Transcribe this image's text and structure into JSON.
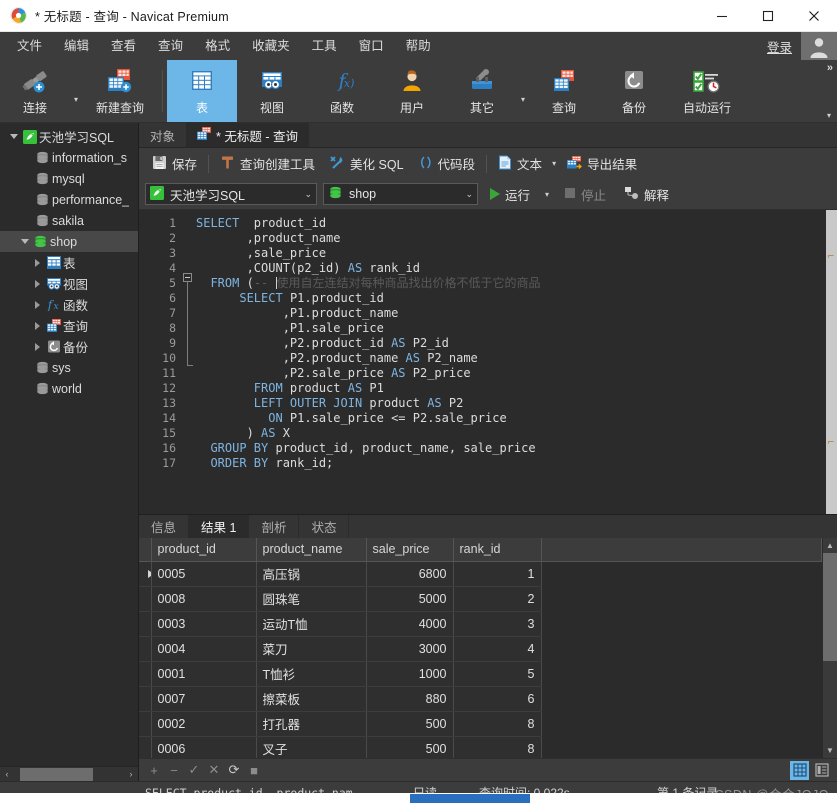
{
  "window": {
    "title": "* 无标题 - 查询 - Navicat Premium",
    "minimize": "—",
    "maximize": "□",
    "close": "✕"
  },
  "menubar": {
    "items": [
      "文件",
      "编辑",
      "查看",
      "查询",
      "格式",
      "收藏夹",
      "工具",
      "窗口",
      "帮助"
    ],
    "login_label": "登录"
  },
  "ribbon": {
    "items": [
      {
        "label": "连接",
        "icon": "connection-icon",
        "selected": false,
        "has_caret": true
      },
      {
        "label": "新建查询",
        "icon": "new-query-icon",
        "selected": false,
        "has_caret": false
      },
      {
        "label": "表",
        "icon": "table-icon",
        "selected": true,
        "has_caret": false
      },
      {
        "label": "视图",
        "icon": "view-icon",
        "selected": false,
        "has_caret": false
      },
      {
        "label": "函数",
        "icon": "function-icon",
        "selected": false,
        "has_caret": false
      },
      {
        "label": "用户",
        "icon": "user-icon",
        "selected": false,
        "has_caret": false
      },
      {
        "label": "其它",
        "icon": "other-tools-icon",
        "selected": false,
        "has_caret": true
      },
      {
        "label": "查询",
        "icon": "query-icon",
        "selected": false,
        "has_caret": false
      },
      {
        "label": "备份",
        "icon": "backup-icon",
        "selected": false,
        "has_caret": false
      },
      {
        "label": "自动运行",
        "icon": "automation-icon",
        "selected": false,
        "has_caret": false
      }
    ],
    "overflow_chevrons": "»"
  },
  "sidebar": {
    "items": [
      {
        "label": "天池学习SQL",
        "icon": "connection-icon",
        "indent": 0,
        "twisty": "down",
        "selected": false
      },
      {
        "label": "information_s",
        "icon": "database-icon",
        "indent": 1,
        "twisty": "none",
        "selected": false
      },
      {
        "label": "mysql",
        "icon": "database-icon",
        "indent": 1,
        "twisty": "none",
        "selected": false
      },
      {
        "label": "performance_",
        "icon": "database-icon",
        "indent": 1,
        "twisty": "none",
        "selected": false
      },
      {
        "label": "sakila",
        "icon": "database-icon",
        "indent": 1,
        "twisty": "none",
        "selected": false
      },
      {
        "label": "shop",
        "icon": "database-open-icon",
        "indent": 1,
        "twisty": "down",
        "selected": true
      },
      {
        "label": "表",
        "icon": "table-icon",
        "indent": 2,
        "twisty": "right",
        "selected": false
      },
      {
        "label": "视图",
        "icon": "view-icon",
        "indent": 2,
        "twisty": "right",
        "selected": false
      },
      {
        "label": "函数",
        "icon": "function-icon",
        "indent": 2,
        "twisty": "right",
        "selected": false
      },
      {
        "label": "查询",
        "icon": "query-icon",
        "indent": 2,
        "twisty": "right",
        "selected": false
      },
      {
        "label": "备份",
        "icon": "backup-icon",
        "indent": 2,
        "twisty": "right",
        "selected": false
      },
      {
        "label": "sys",
        "icon": "database-icon",
        "indent": 1,
        "twisty": "none",
        "selected": false
      },
      {
        "label": "world",
        "icon": "database-icon",
        "indent": 1,
        "twisty": "none",
        "selected": false
      }
    ],
    "hscroll": {
      "left_arrow": "‹",
      "right_arrow": "›"
    }
  },
  "object_tabs": [
    {
      "label": "对象",
      "active": false
    },
    {
      "label": "* 无标题 - 查询",
      "active": true
    }
  ],
  "query_toolbar": {
    "save": "保存",
    "query_builder": "查询创建工具",
    "beautify": "美化 SQL",
    "snippet": "代码段",
    "text": "文本",
    "export_result": "导出结果"
  },
  "query_toolbar2": {
    "connection": "天池学习SQL",
    "database": "shop",
    "run": "运行",
    "stop": "停止",
    "explain": "解释"
  },
  "editor": {
    "lines": [
      {
        "n": 1,
        "segs": [
          {
            "t": "kw",
            "s": "SELECT"
          },
          {
            "t": "p",
            "s": "  product_id"
          }
        ]
      },
      {
        "n": 2,
        "segs": [
          {
            "t": "p",
            "s": "       ,product_name"
          }
        ]
      },
      {
        "n": 3,
        "segs": [
          {
            "t": "p",
            "s": "       ,sale_price"
          }
        ]
      },
      {
        "n": 4,
        "segs": [
          {
            "t": "p",
            "s": "       ,COUNT(p2_id) "
          },
          {
            "t": "kw",
            "s": "AS"
          },
          {
            "t": "p",
            "s": " rank_id"
          }
        ]
      },
      {
        "n": 5,
        "segs": [
          {
            "t": "p",
            "s": "  "
          },
          {
            "t": "kw",
            "s": "FROM"
          },
          {
            "t": "p",
            "s": " ("
          },
          {
            "t": "cmt",
            "s": "-- "
          },
          {
            "t": "caret",
            "s": ""
          },
          {
            "t": "cmt",
            "s": "使用自左连结对每种商品找出价格不低于它的商品"
          }
        ]
      },
      {
        "n": 6,
        "segs": [
          {
            "t": "p",
            "s": "      "
          },
          {
            "t": "kw",
            "s": "SELECT"
          },
          {
            "t": "p",
            "s": " P1.product_id"
          }
        ]
      },
      {
        "n": 7,
        "segs": [
          {
            "t": "p",
            "s": "            ,P1.product_name"
          }
        ]
      },
      {
        "n": 8,
        "segs": [
          {
            "t": "p",
            "s": "            ,P1.sale_price"
          }
        ]
      },
      {
        "n": 9,
        "segs": [
          {
            "t": "p",
            "s": "            ,P2.product_id "
          },
          {
            "t": "kw",
            "s": "AS"
          },
          {
            "t": "p",
            "s": " P2_id"
          }
        ]
      },
      {
        "n": 10,
        "segs": [
          {
            "t": "p",
            "s": "            ,P2.product_name "
          },
          {
            "t": "kw",
            "s": "AS"
          },
          {
            "t": "p",
            "s": " P2_name"
          }
        ]
      },
      {
        "n": 11,
        "segs": [
          {
            "t": "p",
            "s": "            ,P2.sale_price "
          },
          {
            "t": "kw",
            "s": "AS"
          },
          {
            "t": "p",
            "s": " P2_price"
          }
        ]
      },
      {
        "n": 12,
        "segs": [
          {
            "t": "p",
            "s": "        "
          },
          {
            "t": "kw",
            "s": "FROM"
          },
          {
            "t": "p",
            "s": " product "
          },
          {
            "t": "kw",
            "s": "AS"
          },
          {
            "t": "p",
            "s": " P1"
          }
        ]
      },
      {
        "n": 13,
        "segs": [
          {
            "t": "p",
            "s": "        "
          },
          {
            "t": "kw",
            "s": "LEFT OUTER JOIN"
          },
          {
            "t": "p",
            "s": " product "
          },
          {
            "t": "kw",
            "s": "AS"
          },
          {
            "t": "p",
            "s": " P2"
          }
        ]
      },
      {
        "n": 14,
        "segs": [
          {
            "t": "p",
            "s": "          "
          },
          {
            "t": "kw",
            "s": "ON"
          },
          {
            "t": "p",
            "s": " P1.sale_price <= P2.sale_price"
          }
        ]
      },
      {
        "n": 15,
        "segs": [
          {
            "t": "p",
            "s": "       ) "
          },
          {
            "t": "kw",
            "s": "AS"
          },
          {
            "t": "p",
            "s": " X"
          }
        ]
      },
      {
        "n": 16,
        "segs": [
          {
            "t": "p",
            "s": "  "
          },
          {
            "t": "kw",
            "s": "GROUP BY"
          },
          {
            "t": "p",
            "s": " product_id, product_name, sale_price"
          }
        ]
      },
      {
        "n": 17,
        "segs": [
          {
            "t": "p",
            "s": "  "
          },
          {
            "t": "kw",
            "s": "ORDER BY"
          },
          {
            "t": "p",
            "s": " rank_id;"
          }
        ]
      }
    ]
  },
  "result_tabs": [
    {
      "label": "信息",
      "active": false
    },
    {
      "label": "结果 1",
      "active": true
    },
    {
      "label": "剖析",
      "active": false
    },
    {
      "label": "状态",
      "active": false
    }
  ],
  "result_grid": {
    "columns": [
      "product_id",
      "product_name",
      "sale_price",
      "rank_id"
    ],
    "rows": [
      {
        "product_id": "0005",
        "product_name": "高压锅",
        "sale_price": "6800",
        "rank_id": "1",
        "current": true
      },
      {
        "product_id": "0008",
        "product_name": "圆珠笔",
        "sale_price": "5000",
        "rank_id": "2",
        "current": false
      },
      {
        "product_id": "0003",
        "product_name": "运动T恤",
        "sale_price": "4000",
        "rank_id": "3",
        "current": false
      },
      {
        "product_id": "0004",
        "product_name": "菜刀",
        "sale_price": "3000",
        "rank_id": "4",
        "current": false
      },
      {
        "product_id": "0001",
        "product_name": "T恤衫",
        "sale_price": "1000",
        "rank_id": "5",
        "current": false
      },
      {
        "product_id": "0007",
        "product_name": "擦菜板",
        "sale_price": "880",
        "rank_id": "6",
        "current": false
      },
      {
        "product_id": "0002",
        "product_name": "打孔器",
        "sale_price": "500",
        "rank_id": "8",
        "current": false
      },
      {
        "product_id": "0006",
        "product_name": "叉子",
        "sale_price": "500",
        "rank_id": "8",
        "current": false
      }
    ]
  },
  "result_toolbar": {
    "add": "+",
    "remove": "−",
    "apply": "✓",
    "cancel": "✕",
    "refresh": "⟳",
    "stop": "■",
    "grid_view": "grid-view-icon",
    "form_view": "form-view-icon"
  },
  "statusbar": {
    "query_text": "SELECT  product_id       ,product_nam",
    "readonly": "只读",
    "query_time": "查询时间: 0.022s",
    "record": "第 1 条记录",
    "watermark": "CSDN @合合JOJO"
  },
  "colors": {
    "accent_blue": "#6cb6e8",
    "ribbon_bg": "#3c3c3c",
    "panel_bg": "#2b2b2b",
    "keyword": "#7fb4e0",
    "comment": "#5a5a5a",
    "run_green": "#3aa63a"
  }
}
